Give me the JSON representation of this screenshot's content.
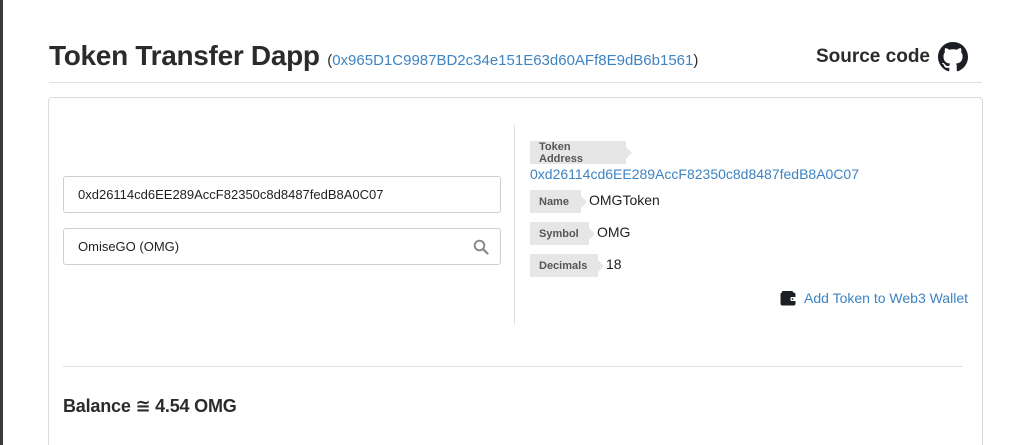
{
  "header": {
    "title": "Token Transfer Dapp",
    "paren_open": "(",
    "contract_address": "0x965D1C9987BD2c34e151E63d60AFf8E9dB6b1561",
    "paren_close": ")",
    "source_label": "Source code"
  },
  "form": {
    "address_value": "0xd26114cd6EE289AccF82350c8d8487fedB8A0C07",
    "token_select_value": "OmiseGO (OMG)"
  },
  "token_info": {
    "address_label": "Token Address",
    "address_value": "0xd26114cd6EE289AccF82350c8d8487fedB8A0C07",
    "name_label": "Name",
    "name_value": "OMGToken",
    "symbol_label": "Symbol",
    "symbol_value": "OMG",
    "decimals_label": "Decimals",
    "decimals_value": "18",
    "add_wallet_label": "Add Token to Web3 Wallet"
  },
  "balance": {
    "text": "Balance ≅ 4.54 OMG"
  },
  "icons": {
    "github": "github-icon",
    "search": "search-icon",
    "wallet": "wallet-icon"
  },
  "colors": {
    "link": "#3e83c2",
    "tag_bg": "#e6e6e6",
    "text": "#2b2b2b"
  }
}
